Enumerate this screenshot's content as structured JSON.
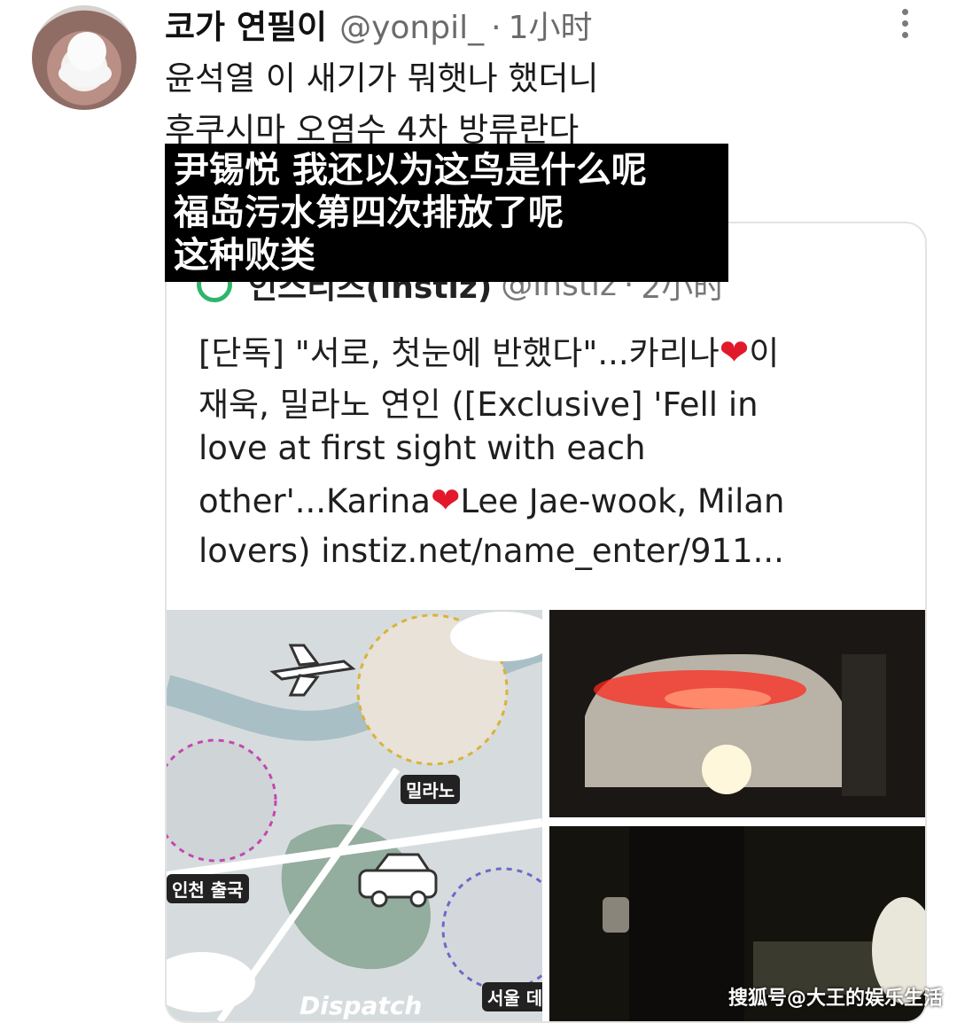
{
  "tweet": {
    "display_name": "코가 연필이",
    "handle": "@yonpil_",
    "separator": "·",
    "time": "1小时",
    "lines": [
      "윤석열 이 새기가 뭐햇나 했더니",
      "후쿠시마 오염수 4차 방류란다"
    ]
  },
  "translation_overlay": {
    "lines": [
      "尹锡悦 我还以为这鸟是什么呢",
      "福岛污水第四次排放了呢",
      "这种败类"
    ]
  },
  "quoted": {
    "source_name": "인스티즈(instiz)",
    "handle": "@instiz",
    "separator": "·",
    "time": "2小时",
    "text_lines": [
      {
        "before": "[단독] \"서로, 첫눈에 반했다\"...카리나",
        "heart": "❤",
        "after": "이"
      },
      {
        "before": "재욱, 밀라노 연인 ([Exclusive] 'Fell in",
        "heart": "",
        "after": ""
      },
      {
        "before": "love at first sight with each",
        "heart": "",
        "after": ""
      },
      {
        "before": "other'...Karina",
        "heart": "❤",
        "after": "Lee Jae-wook, Milan"
      },
      {
        "before": "lovers) instiz.net/name_enter/911...",
        "heart": "",
        "after": ""
      }
    ],
    "map_labels": {
      "milan": "밀라노",
      "incheon": "인천 출국",
      "seoul": "서울 데",
      "brand": "Dispatch"
    }
  },
  "watermark": "搜狐号@大王的娱乐生活",
  "colors": {
    "heart": "#e1192b",
    "overlay_bg": "#000000",
    "logo_ring": "#2fb56a"
  },
  "icons": {
    "more": "vertical-dots-icon",
    "plane": "airplane-icon",
    "car": "car-icon"
  }
}
